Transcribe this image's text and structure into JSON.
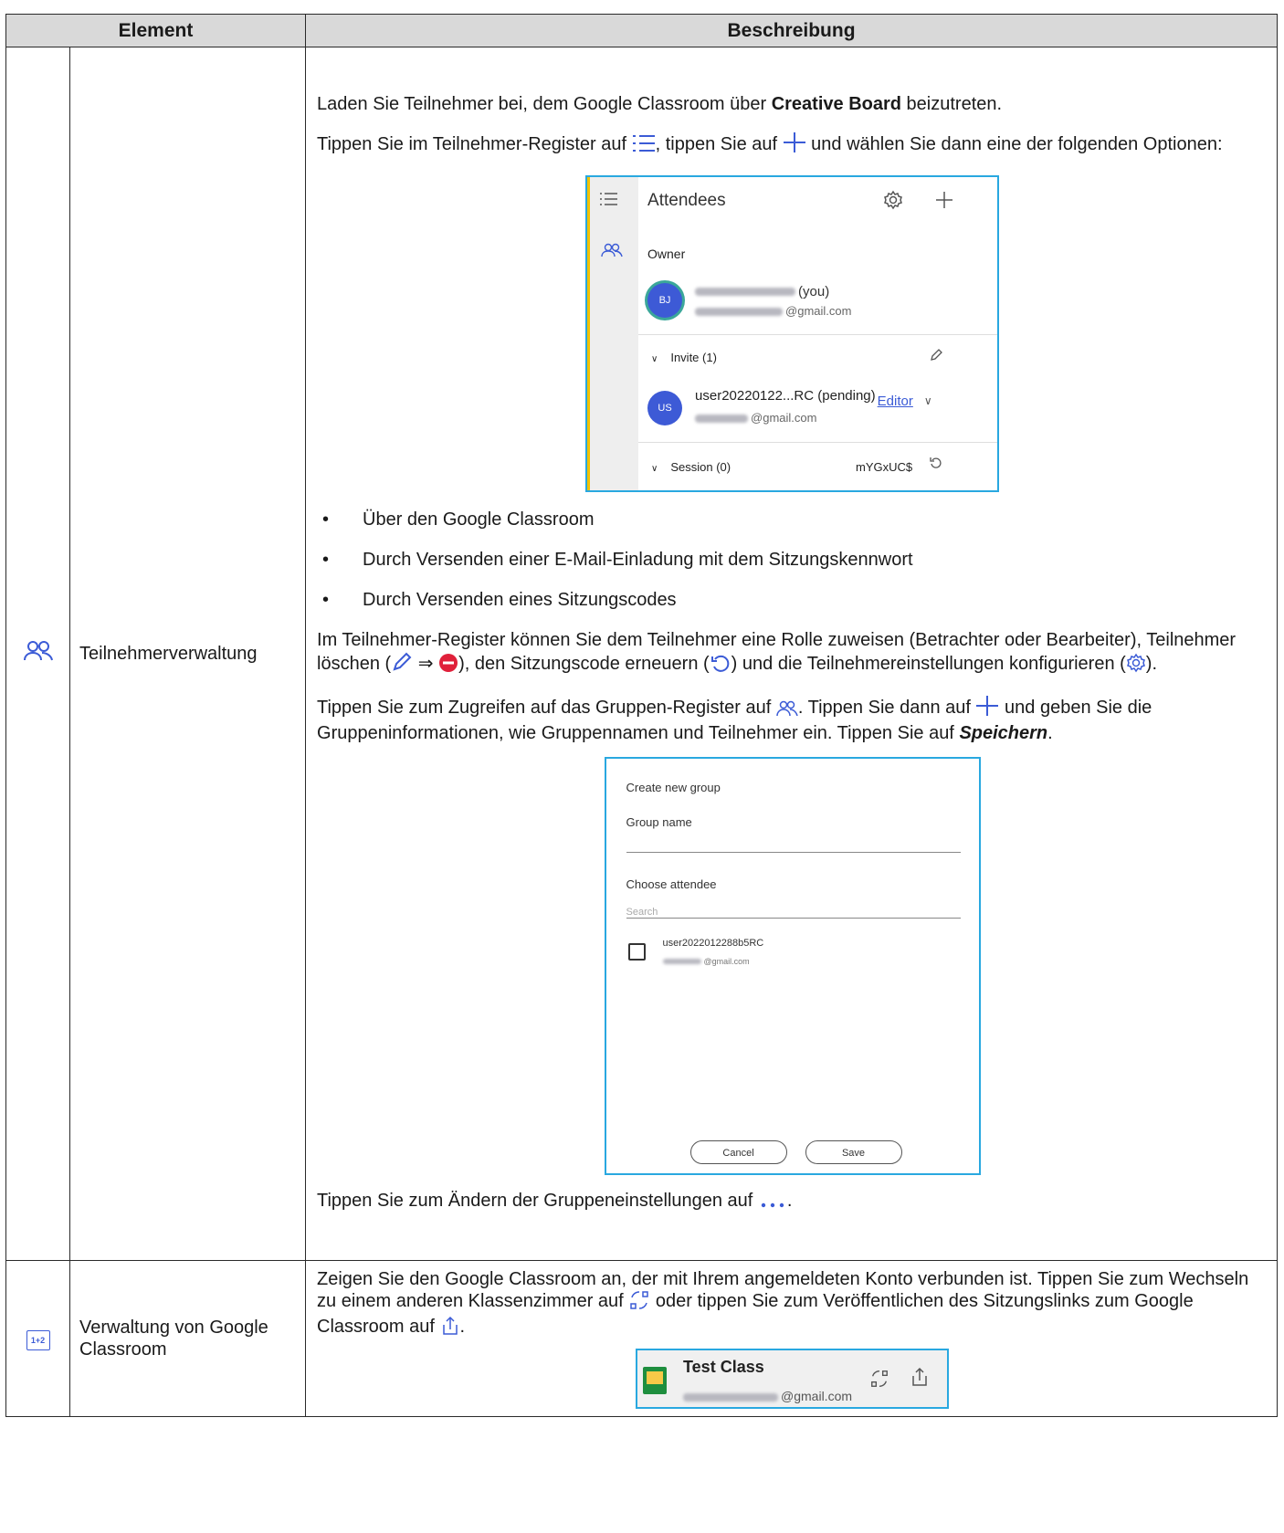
{
  "header": {
    "element": "Element",
    "description": "Beschreibung"
  },
  "row1": {
    "icon": "attendees-icon",
    "name": "Teilnehmerverwaltung",
    "intro_a": "Laden Sie Teilnehmer bei, dem Google Classroom über ",
    "intro_bold": "Creative Board",
    "intro_b": " beizutreten.",
    "tap_a": "Tippen Sie im Teilnehmer-Register auf ",
    "tap_b": ", tippen Sie auf ",
    "tap_c": " und wählen Sie dann eine der folgenden Optionen:",
    "attendees_panel": {
      "title": "Attendees",
      "owner_label": "Owner",
      "owner_initials": "BJ",
      "owner_suffix": "(you)",
      "owner_email_suffix": "@gmail.com",
      "invite_label": "Invite (1)",
      "invitee_initials": "US",
      "invitee_name": "user20220122...RC (pending)",
      "invitee_role": "Editor",
      "invitee_email_suffix": "@gmail.com",
      "session_label": "Session (0)",
      "session_code": "mYGxUC$"
    },
    "bullets": [
      "Über den Google Classroom",
      "Durch Versenden einer E-Mail-Einladung mit dem Sitzungskennwort",
      "Durch Versenden eines Sitzungscodes"
    ],
    "role_a": "Im Teilnehmer-Register können Sie dem Teilnehmer eine Rolle zuweisen (Betrachter oder Bearbeiter), Teilnehmer löschen (",
    "role_arrow": "⇒",
    "role_b": "), den Sitzungscode erneuern (",
    "role_c": ") und die Teilnehmereinstellungen konfigurieren (",
    "role_d": ").",
    "group_a": "Tippen Sie zum Zugreifen auf das Gruppen-Register auf ",
    "group_b": ". Tippen Sie dann auf ",
    "group_c": " und geben Sie die Gruppeninformationen, wie Gruppennamen und Teilnehmer ein. Tippen Sie auf ",
    "group_save": "Speichern",
    "group_d": ".",
    "group_panel": {
      "title": "Create new group",
      "group_name_label": "Group name",
      "choose_label": "Choose attendee",
      "search_placeholder": "Search",
      "attendee_name": "user2022012288b5RC",
      "attendee_email_suffix": "@gmail.com",
      "cancel": "Cancel",
      "save": "Save"
    },
    "change_a": "Tippen Sie zum Ändern der Gruppeneinstellungen auf ",
    "change_b": "."
  },
  "row2": {
    "icon": "calculator-board-icon",
    "icon_text": "1+2",
    "name": "Verwaltung von Google Classroom",
    "text_a": "Zeigen Sie den Google Classroom an, der mit Ihrem angemeldeten Konto verbunden ist. Tippen Sie zum Wechseln zu einem anderen Klassenzimmer auf ",
    "text_b": " oder tippen Sie zum Veröffentlichen des Sitzungslinks zum Google Classroom auf ",
    "text_c": ".",
    "class_panel": {
      "title": "Test Class",
      "email_suffix": "@gmail.com"
    }
  },
  "colors": {
    "accent": "#29a8e0",
    "icon_blue": "#3b5bd6",
    "delete_red": "#e0203a",
    "header_bg": "#d9d9d9"
  }
}
